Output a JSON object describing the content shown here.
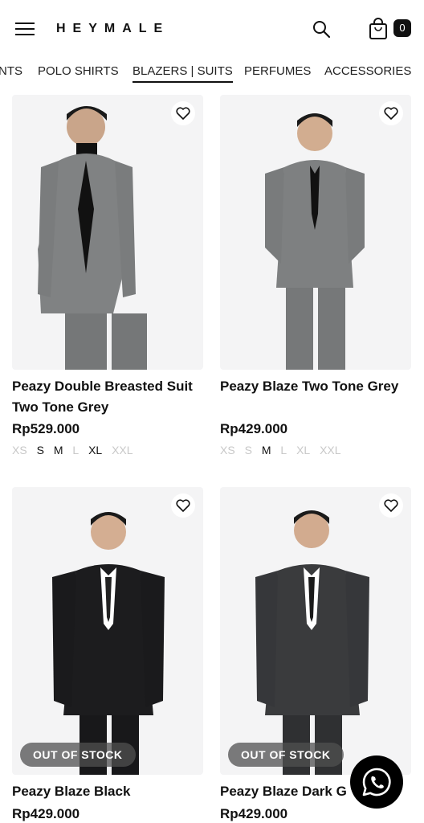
{
  "header": {
    "logo": "HEYMALE",
    "cart_count": "0"
  },
  "tabs": [
    {
      "label": "NTS"
    },
    {
      "label": "POLO SHIRTS"
    },
    {
      "label": "BLAZERS | SUITS",
      "active": true
    },
    {
      "label": "PERFUMES"
    },
    {
      "label": "ACCESSORIES"
    }
  ],
  "products": [
    {
      "name": "Peazy Double Breasted Suit Two Tone Grey",
      "price": "Rp529.000",
      "sizes": [
        {
          "label": "XS",
          "available": false
        },
        {
          "label": "S",
          "available": true
        },
        {
          "label": "M",
          "available": true
        },
        {
          "label": "L",
          "available": false
        },
        {
          "label": "XL",
          "available": true
        },
        {
          "label": "XXL",
          "available": false
        }
      ],
      "out_of_stock": false
    },
    {
      "name": "Peazy Blaze Two Tone Grey",
      "price": "Rp429.000",
      "sizes": [
        {
          "label": "XS",
          "available": false
        },
        {
          "label": "S",
          "available": false
        },
        {
          "label": "M",
          "available": true
        },
        {
          "label": "L",
          "available": false
        },
        {
          "label": "XL",
          "available": false
        },
        {
          "label": "XXL",
          "available": false
        }
      ],
      "out_of_stock": false
    },
    {
      "name": "Peazy Blaze Black",
      "price": "Rp429.000",
      "out_of_stock": true,
      "badge": "OUT OF STOCK"
    },
    {
      "name": "Peazy Blaze Dark G",
      "price": "Rp429.000",
      "out_of_stock": true,
      "badge": "OUT OF STOCK"
    }
  ],
  "colors": {
    "suit_grey": "#7d7f80",
    "suit_black": "#1c1c1e",
    "suit_charcoal": "#3a3b3d",
    "card_bg": "#f4f4f5"
  }
}
